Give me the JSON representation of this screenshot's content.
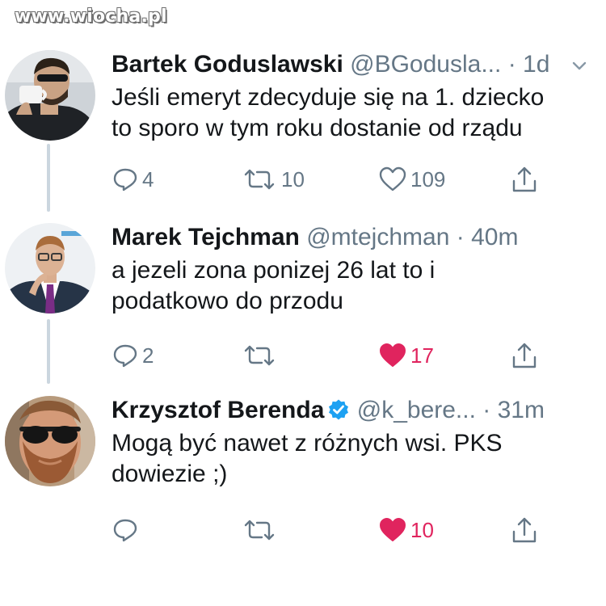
{
  "watermark": "www.wiocha.pl",
  "tweets": [
    {
      "name": "Bartek Goduslawski",
      "handle": "@BGodusla...",
      "dot": "·",
      "time": "1d",
      "verified": false,
      "text": [
        "Jeśli emeryt zdecyduje się na 1. dziecko",
        "to sporo w tym roku dostanie od rządu"
      ],
      "replies": "4",
      "retweets": "10",
      "likes": "109",
      "liked": false,
      "avatar": "man-with-sunglasses-and-cup"
    },
    {
      "name": "Marek Tejchman",
      "handle": "@mtejchman",
      "dot": "·",
      "time": "40m",
      "verified": false,
      "text": [
        "a jezeli zona ponizej 26 lat to i",
        "podatkowo do przodu"
      ],
      "replies": "2",
      "retweets": "",
      "likes": "17",
      "liked": true,
      "avatar": "man-in-suit-with-purple-tie"
    },
    {
      "name": "Krzysztof Berenda",
      "handle": "@k_bere...",
      "dot": "·",
      "time": "31m",
      "verified": true,
      "text": [
        "Mogą być nawet z różnych wsi. PKS",
        "dowiezie ;)"
      ],
      "replies": "",
      "retweets": "",
      "likes": "10",
      "liked": true,
      "avatar": "bearded-man-with-sunglasses"
    }
  ],
  "icons": {
    "reply": "reply-icon",
    "retweet": "retweet-icon",
    "like": "heart-icon",
    "share": "share-icon",
    "verified": "verified-badge-icon",
    "chevron": "chevron-down-icon"
  },
  "colors": {
    "text": "#14171a",
    "secondary": "#657786",
    "like": "#e0245e",
    "verified": "#1da1f2",
    "thread_line": "#cbd6df"
  }
}
